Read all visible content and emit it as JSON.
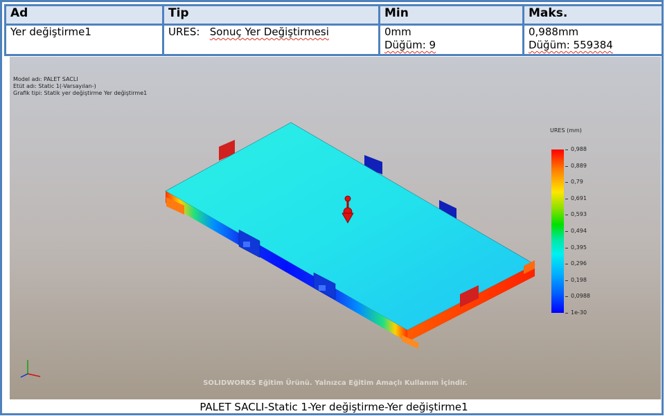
{
  "table": {
    "headers": {
      "name": "Ad",
      "type": "Tip",
      "min": "Min",
      "max": "Maks."
    },
    "row": {
      "name": "Yer değiştirme1",
      "type_prefix": "URES:",
      "type_desc": "Sonuç Yer Değiştirmesi",
      "min_value": "0mm",
      "min_node": "Düğüm: 9",
      "max_value": "0,988mm",
      "max_node": "Düğüm: 559384"
    }
  },
  "viewport": {
    "model_name": "Model adı: PALET SACLI",
    "study_name": "Etüt adı: Static 1(-Varsayılan-)",
    "plot_type": "Grafik tipi: Statik yer değiştirme Yer değiştirme1",
    "watermark": "SOLIDWORKS Eğitim Ürünü. Yalnızca Eğitim Amaçlı Kullanım İçindir."
  },
  "legend": {
    "title": "URES (mm)",
    "labels": [
      "0,988",
      "0,889",
      "0,79",
      "0,691",
      "0,593",
      "0,494",
      "0,395",
      "0,296",
      "0,198",
      "0,0988",
      "1e-30"
    ]
  },
  "caption": "PALET SACLI-Static 1-Yer değiştirme-Yer değiştirme1",
  "colors": {
    "table_border": "#4f81bd",
    "header_fill": "#dbe5f1"
  }
}
